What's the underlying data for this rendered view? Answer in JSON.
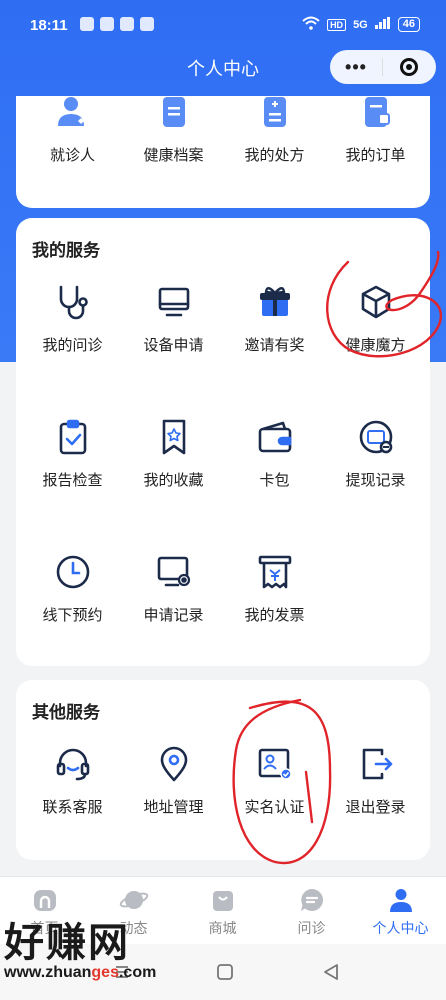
{
  "status_bar": {
    "time": "18:11",
    "network": "5G",
    "hd": "HD",
    "battery": "46"
  },
  "header": {
    "title": "个人中心",
    "more_label": "•••"
  },
  "top_shortcuts": [
    {
      "label": "就诊人",
      "icon": "patient-icon"
    },
    {
      "label": "健康档案",
      "icon": "health-record-icon"
    },
    {
      "label": "我的处方",
      "icon": "prescription-icon"
    },
    {
      "label": "我的订单",
      "icon": "order-icon"
    }
  ],
  "my_services": {
    "title": "我的服务",
    "items": [
      {
        "label": "我的问诊",
        "icon": "stethoscope-icon"
      },
      {
        "label": "设备申请",
        "icon": "monitor-icon"
      },
      {
        "label": "邀请有奖",
        "icon": "gift-icon"
      },
      {
        "label": "健康魔方",
        "icon": "cube-icon"
      },
      {
        "label": "报告检查",
        "icon": "clipboard-check-icon"
      },
      {
        "label": "我的收藏",
        "icon": "bookmark-icon"
      },
      {
        "label": "卡包",
        "icon": "wallet-icon"
      },
      {
        "label": "提现记录",
        "icon": "withdraw-record-icon"
      },
      {
        "label": "线下预约",
        "icon": "clock-icon"
      },
      {
        "label": "申请记录",
        "icon": "application-record-icon"
      },
      {
        "label": "我的发票",
        "icon": "invoice-icon"
      }
    ]
  },
  "other_services": {
    "title": "其他服务",
    "items": [
      {
        "label": "联系客服",
        "icon": "headset-icon"
      },
      {
        "label": "地址管理",
        "icon": "location-pin-icon"
      },
      {
        "label": "实名认证",
        "icon": "id-card-icon"
      },
      {
        "label": "退出登录",
        "icon": "logout-icon"
      }
    ]
  },
  "tab_bar": {
    "tabs": [
      {
        "label": "首页",
        "icon": "home-icon",
        "active": false
      },
      {
        "label": "动态",
        "icon": "planet-icon",
        "active": false
      },
      {
        "label": "商城",
        "icon": "shop-bag-icon",
        "active": false
      },
      {
        "label": "问诊",
        "icon": "chat-icon",
        "active": false
      },
      {
        "label": "个人中心",
        "icon": "user-icon",
        "active": true
      }
    ]
  },
  "watermark": {
    "brand": "好赚网",
    "url_prefix": "www.zhuan",
    "url_highlight": "ges",
    "url_suffix": ".com"
  },
  "colors": {
    "primary": "#2f6ef3",
    "annotation": "#e0242a",
    "text": "#222222",
    "icon_dark": "#1c2b4a"
  }
}
